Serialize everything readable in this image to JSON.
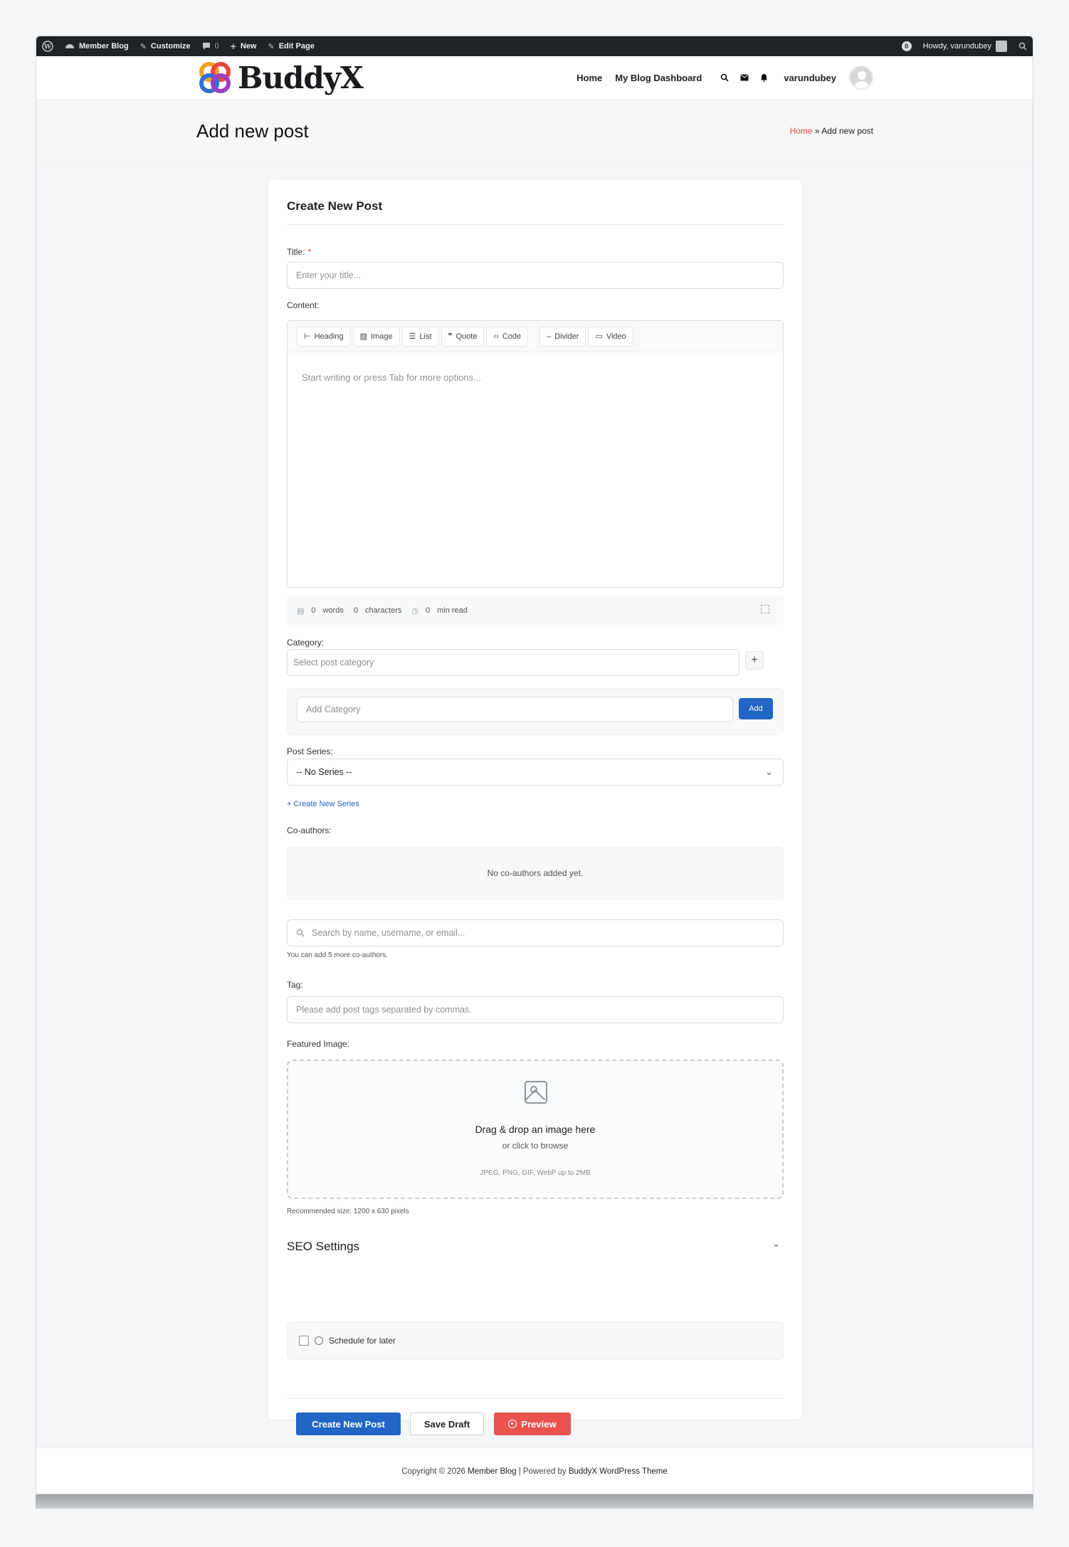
{
  "admin_bar": {
    "site_name": "Member Blog",
    "customize": "Customize",
    "comments_count": "0",
    "new": "New",
    "edit_page": "Edit Page",
    "notif_count": "0",
    "howdy": "Howdy, varundubey"
  },
  "header": {
    "logo_text": "BuddyX",
    "nav": [
      "Home",
      "My Blog Dashboard"
    ],
    "username": "varundubey"
  },
  "title_bar": {
    "title": "Add new post",
    "breadcrumb_home": "Home",
    "breadcrumb_sep": " » ",
    "breadcrumb_current": "Add new post"
  },
  "form": {
    "heading": "Create New Post",
    "title_label": "Title:",
    "title_required": "*",
    "title_placeholder": "Enter your title...",
    "content_label": "Content:",
    "toolbar": [
      "Heading",
      "Image",
      "List",
      "Quote",
      "Code",
      "Divider",
      "Video"
    ],
    "editor_placeholder": "Start writing or press Tab for more options...",
    "stats": {
      "words_count": "0",
      "words_label": "words",
      "chars_count": "0",
      "chars_label": "characters",
      "read_count": "0",
      "read_label": "min read"
    },
    "category_label": "Category:",
    "category_placeholder": "Select post category",
    "add_category_placeholder": "Add Category",
    "add_button": "Add",
    "series_label": "Post Series:",
    "series_value": "-- No Series --",
    "create_series_link": "+ Create New Series",
    "coauthors_label": "Co-authors:",
    "coauthors_empty": "No co-authors added yet.",
    "coauthor_search_placeholder": "Search by name, username, or email...",
    "coauthor_help": "You can add 5 more co-authors.",
    "tag_label": "Tag:",
    "tag_placeholder": "Please add post tags separated by commas.",
    "featured_label": "Featured Image:",
    "dropzone_title": "Drag & drop an image here",
    "dropzone_sub": "or click to browse",
    "dropzone_note": "JPEG, PNG, GIF, WebP up to 2MB",
    "recommended_size": "Recommended size: 1200 x 630 pixels",
    "seo_heading": "SEO Settings",
    "schedule_label": "Schedule for later",
    "buttons": {
      "create": "Create New Post",
      "draft": "Save Draft",
      "preview": "Preview"
    }
  },
  "footer": {
    "prefix": "Copyright © 2026 ",
    "site": "Member Blog",
    "middle": " | Powered by ",
    "theme": "BuddyX WordPress Theme"
  },
  "colors": {
    "accent_blue": "#2165c5",
    "preview_red": "#e9524e",
    "breadcrumb_home": "#e4473b",
    "admin_bar": "#1d2327"
  }
}
